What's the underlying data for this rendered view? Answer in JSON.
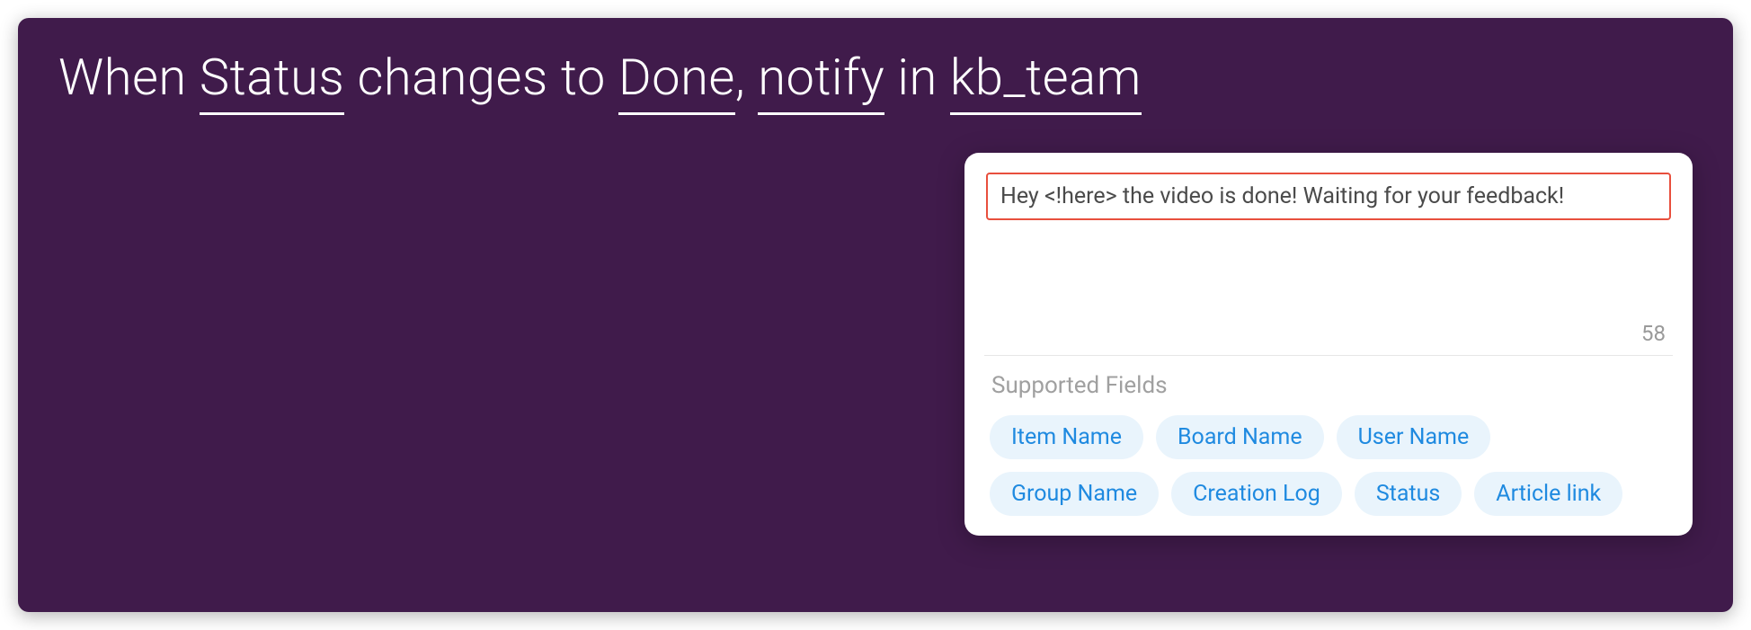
{
  "sentence": {
    "prefix": "When",
    "column": "Status",
    "middle1": "changes to",
    "value": "Done",
    "comma": ",",
    "action": "notify",
    "middle2": "in",
    "channel": "kb_team"
  },
  "message": {
    "text": "Hey <!here> the video is done! Waiting for your feedback!",
    "char_count": "58"
  },
  "fields_label": "Supported Fields",
  "fields": [
    "Item Name",
    "Board Name",
    "User Name",
    "Group Name",
    "Creation Log",
    "Status",
    "Article link"
  ]
}
